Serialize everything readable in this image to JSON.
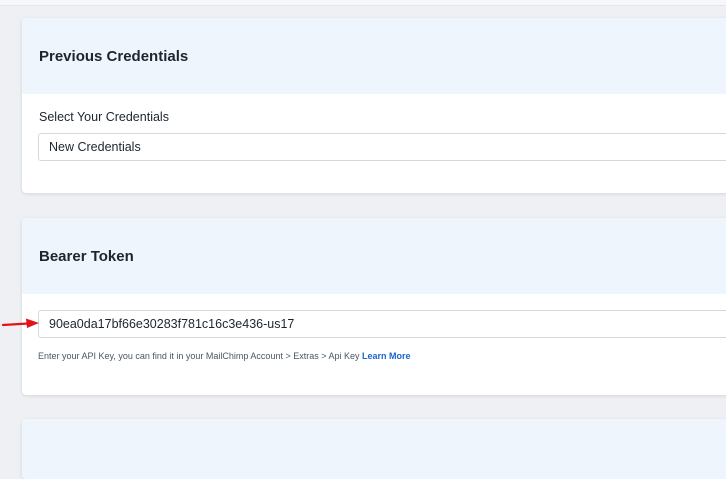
{
  "previous_credentials": {
    "title": "Previous Credentials",
    "select_label": "Select Your Credentials",
    "selected_value": "New Credentials"
  },
  "bearer_token": {
    "title": "Bearer Token",
    "input_value": "90ea0da17bf66e30283f781c16c3e436-us17",
    "help_text": "Enter your API Key, you can find it in your MailChimp Account > Extras > Api Key",
    "help_link": "Learn More"
  },
  "colors": {
    "accent": "#1a66d1",
    "arrow": "#e2141a",
    "header_bg": "#eef5fd"
  },
  "icons": {
    "annotation": "red-arrow-icon"
  }
}
